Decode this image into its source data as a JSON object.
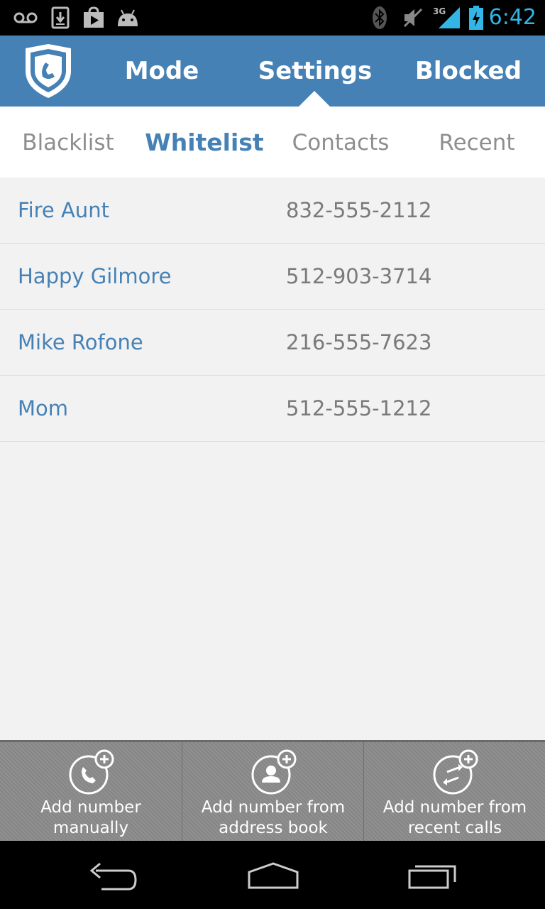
{
  "status_bar": {
    "time": "6:42",
    "network": "3G",
    "icons": [
      "voicemail-icon",
      "download-icon",
      "play-store-icon",
      "android-icon",
      "bluetooth-icon",
      "mute-icon",
      "signal-icon",
      "battery-charging-icon"
    ],
    "accent_color": "#33b5e5"
  },
  "action_bar": {
    "logo_icon": "shield-phone-icon",
    "tabs": [
      {
        "label": "Mode"
      },
      {
        "label": "Settings",
        "selected": true
      },
      {
        "label": "Blocked"
      }
    ],
    "background_color": "#4681b5"
  },
  "sub_tabs": [
    {
      "label": "Blacklist"
    },
    {
      "label": "Whitelist",
      "selected": true
    },
    {
      "label": "Contacts"
    },
    {
      "label": "Recent"
    }
  ],
  "whitelist": [
    {
      "name": "Fire Aunt",
      "phone": "832-555-2112"
    },
    {
      "name": "Happy Gilmore",
      "phone": "512-903-3714"
    },
    {
      "name": "Mike Rofone",
      "phone": "216-555-7623"
    },
    {
      "name": "Mom",
      "phone": "512-555-1212"
    }
  ],
  "bottom_actions": [
    {
      "line1": "Add number",
      "line2": "manually",
      "icon": "add-phone-icon"
    },
    {
      "line1": "Add number from",
      "line2": "address book",
      "icon": "add-contact-icon"
    },
    {
      "line1": "Add number from",
      "line2": "recent calls",
      "icon": "add-recent-calls-icon"
    }
  ],
  "nav_bar": {
    "icons": [
      "back-icon",
      "home-icon",
      "recent-apps-icon"
    ]
  }
}
